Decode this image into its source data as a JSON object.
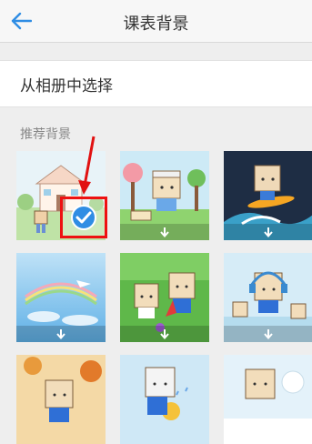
{
  "header": {
    "title": "课表背景",
    "back_icon": "arrow-left-icon",
    "back_color": "#2f8de4"
  },
  "album": {
    "label": "从相册中选择"
  },
  "section": {
    "label": "推荐背景"
  },
  "backgrounds": [
    {
      "name": "school-building",
      "selected": true,
      "download": false
    },
    {
      "name": "kite-park",
      "selected": false,
      "download": true
    },
    {
      "name": "surf-wave",
      "selected": false,
      "download": true
    },
    {
      "name": "blue-sky-plane",
      "selected": false,
      "download": true
    },
    {
      "name": "green-field-friends",
      "selected": false,
      "download": true
    },
    {
      "name": "music-headphones",
      "selected": false,
      "download": true
    },
    {
      "name": "autumn-leaves",
      "selected": false,
      "download": false
    },
    {
      "name": "rainy-umbrella",
      "selected": false,
      "download": false
    },
    {
      "name": "snow-scene",
      "selected": false,
      "download": false
    }
  ],
  "accent": "#2f8de4",
  "annotation_color": "#e11111"
}
